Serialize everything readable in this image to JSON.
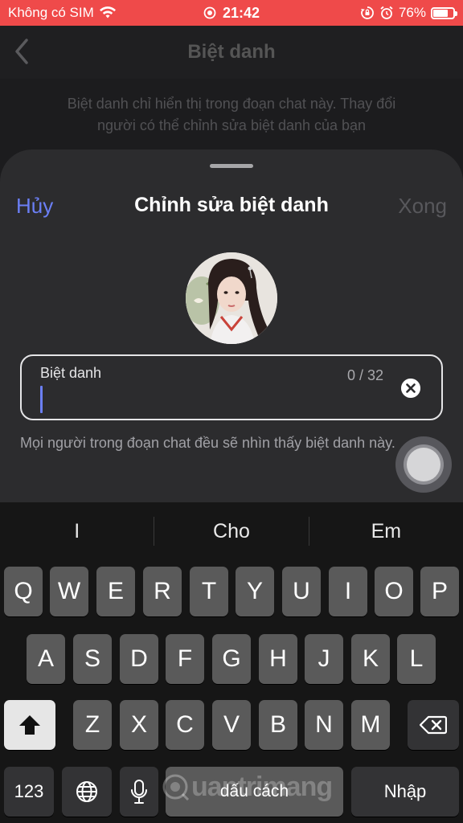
{
  "status_bar": {
    "carrier": "Không có SIM",
    "time": "21:42",
    "battery_percent": "76%",
    "battery_level": 0.76
  },
  "background_page": {
    "title": "Biệt danh",
    "description": "Biệt danh chỉ hiển thị trong đoạn chat này. Thay đổi người có thể chỉnh sửa biệt danh của bạn"
  },
  "sheet": {
    "cancel_label": "Hủy",
    "title": "Chỉnh sửa biệt danh",
    "done_label": "Xong",
    "input": {
      "label": "Biệt danh",
      "value": "",
      "counter": "0 / 32"
    },
    "hint": "Mọi người trong đoạn chat đều sẽ nhìn thấy biệt danh này."
  },
  "keyboard": {
    "suggestions": [
      "I",
      "Cho",
      "Em"
    ],
    "row1": [
      "Q",
      "W",
      "E",
      "R",
      "T",
      "Y",
      "U",
      "I",
      "O",
      "P"
    ],
    "row2": [
      "A",
      "S",
      "D",
      "F",
      "G",
      "H",
      "J",
      "K",
      "L"
    ],
    "row3": [
      "Z",
      "X",
      "C",
      "V",
      "B",
      "N",
      "M"
    ],
    "numbers_label": "123",
    "space_label": "dấu cách",
    "return_label": "Nhập"
  },
  "watermark": "uantrimang",
  "colors": {
    "status_bar": "#ef4a4a",
    "accent": "#6b7ff5",
    "sheet_bg": "#2c2c2e",
    "keyboard_bg": "#161616",
    "key_bg": "#5a5a5a"
  },
  "icons": {
    "back": "chevron-left-icon",
    "wifi": "wifi-icon",
    "clear": "close-circle-icon",
    "shift": "shift-arrow-icon",
    "backspace": "backspace-icon",
    "globe": "globe-icon",
    "mic": "microphone-icon"
  }
}
